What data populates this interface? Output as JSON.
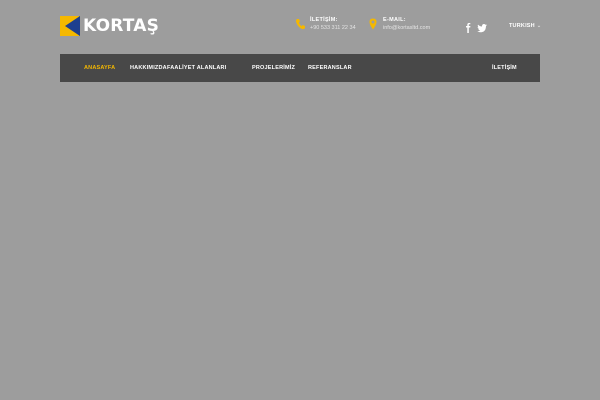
{
  "brand": {
    "name": "KORTAŞ"
  },
  "contact": {
    "phone_label": "İLETİŞİM:",
    "phone_value": "+90 533 311 22 34",
    "email_label": "E-MAIL:",
    "email_value": "info@kortasltd.com"
  },
  "social": {
    "facebook": "facebook-icon",
    "twitter": "twitter-icon"
  },
  "language": {
    "selected": "TURKISH",
    "caret": "⌄"
  },
  "nav": {
    "items": [
      {
        "label": "ANASAYFA",
        "active": true
      },
      {
        "label": "HAKKIMIZDA"
      },
      {
        "label": "FAALİYET ALANLARI"
      },
      {
        "label": "PROJELERİMİZ"
      },
      {
        "label": "REFERANSLAR"
      }
    ],
    "right_item": "İLETİŞİM"
  },
  "colors": {
    "accent": "#f5b800",
    "nav_bg": "#484848",
    "page_bg": "#9d9d9d",
    "logo_blue": "#1e3f8f"
  }
}
